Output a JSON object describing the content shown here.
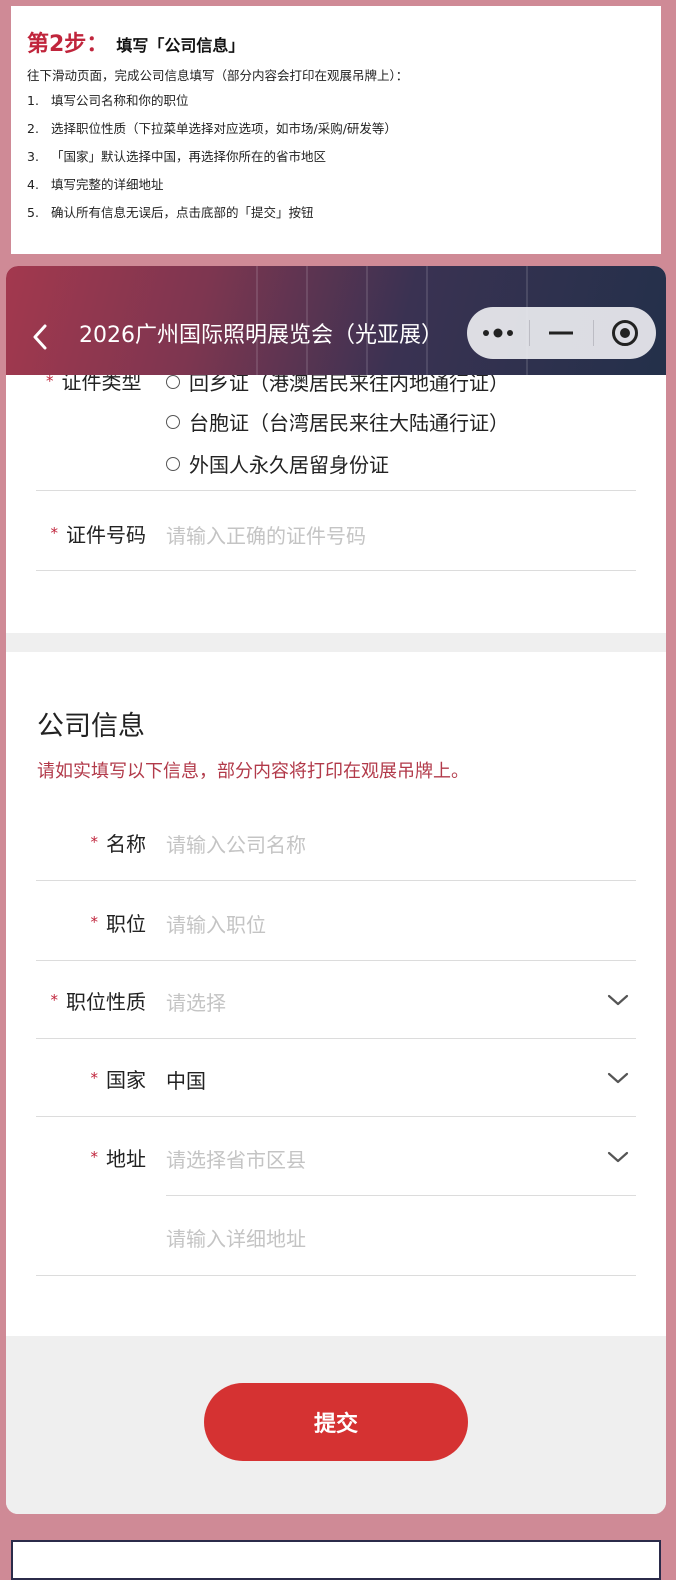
{
  "guide": {
    "step_no": "第2步：",
    "step_title": "填写「公司信息」",
    "intro": "往下滑动页面，完成公司信息填写（部分内容会打印在观展吊牌上）：",
    "items": [
      {
        "num": "1.",
        "text": "填写公司名称和你的职位"
      },
      {
        "num": "2.",
        "text": "选择职位性质（下拉菜单选择对应选项，如市场/采购/研发等）"
      },
      {
        "num": "3.",
        "text": "「国家」默认选择中国，再选择你所在的省市地区"
      },
      {
        "num": "4.",
        "text": "填写完整的详细地址"
      },
      {
        "num": "5.",
        "text": "确认所有信息无误后，点击底部的「提交」按钮"
      }
    ]
  },
  "nav": {
    "title": "2026广州国际照明展览会（光亚展）"
  },
  "id_section": {
    "required_mark": "*",
    "type_label": "证件类型",
    "options": [
      "回乡证（港澳居民来往内地通行证）",
      "台胞证（台湾居民来往大陆通行证）",
      "外国人永久居留身份证"
    ],
    "number_label": "证件号码",
    "number_placeholder": "请输入正确的证件号码"
  },
  "company": {
    "title": "公司信息",
    "note": "请如实填写以下信息，部分内容将打印在观展吊牌上。",
    "required_mark": "*",
    "name_label": "名称",
    "name_placeholder": "请输入公司名称",
    "position_label": "职位",
    "position_placeholder": "请输入职位",
    "nature_label": "职位性质",
    "nature_placeholder": "请选择",
    "country_label": "国家",
    "country_value": "中国",
    "address_label": "地址",
    "address_placeholder": "请选择省市区县",
    "detail_placeholder": "请输入详细地址"
  },
  "submit_label": "提交"
}
